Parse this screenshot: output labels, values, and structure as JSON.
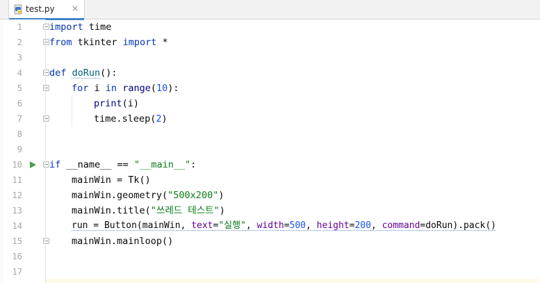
{
  "tab": {
    "filename": "test.py",
    "close_glyph": "×",
    "icon": "python-file-icon"
  },
  "gutter": {
    "line_numbers": [
      "1",
      "2",
      "3",
      "4",
      "5",
      "6",
      "7",
      "8",
      "9",
      "10",
      "11",
      "12",
      "13",
      "14",
      "15",
      "16",
      "17"
    ],
    "run_icon": "run-triangle-icon",
    "run_icon_color": "#499c54"
  },
  "code": {
    "l1": {
      "kw": "import",
      "rest": " time"
    },
    "l2": {
      "kw1": "from",
      "mid": " tkinter ",
      "kw2": "import",
      "rest": " *"
    },
    "l4": {
      "kw": "def",
      "fn": "doRun",
      "rest": "():"
    },
    "l5": {
      "kw1": "for",
      "mid": " i ",
      "kw2": "in",
      "bi": "range",
      "open": "(",
      "num": "10",
      "close": "):"
    },
    "l6": {
      "bi": "print",
      "rest": "(i)"
    },
    "l7": {
      "pre": "time.sleep(",
      "num": "2",
      "rest": ")"
    },
    "l10": {
      "kw": "if",
      "mid": " __name__ == ",
      "str": "\"__main__\"",
      "rest": ":"
    },
    "l11": {
      "text": "mainWin = Tk()"
    },
    "l12": {
      "pre": "mainWin.geometry(",
      "str": "\"500x200\"",
      "rest": ")"
    },
    "l13": {
      "pre": "mainWin.title(",
      "str": "\"쓰레드 테스트\"",
      "rest": ")"
    },
    "l14": {
      "pre": "run = Button(mainWin, ",
      "p1": "text",
      "eq1": "=",
      "s1": "\"실행\"",
      "c1": ", ",
      "p2": "width",
      "eq2": "=",
      "n1": "500",
      "c2": ", ",
      "p3": "height",
      "eq3": "=",
      "n2": "200",
      "c3": ", ",
      "p4": "command",
      "eq4": "=doRun).pack()"
    },
    "l15": {
      "text": "mainWin.mainloop()"
    }
  },
  "colors": {
    "keyword": "#0033b3",
    "string": "#067d17",
    "number": "#1750eb",
    "parameter": "#660099",
    "function": "#00627a",
    "tab_accent": "#4083c9"
  }
}
